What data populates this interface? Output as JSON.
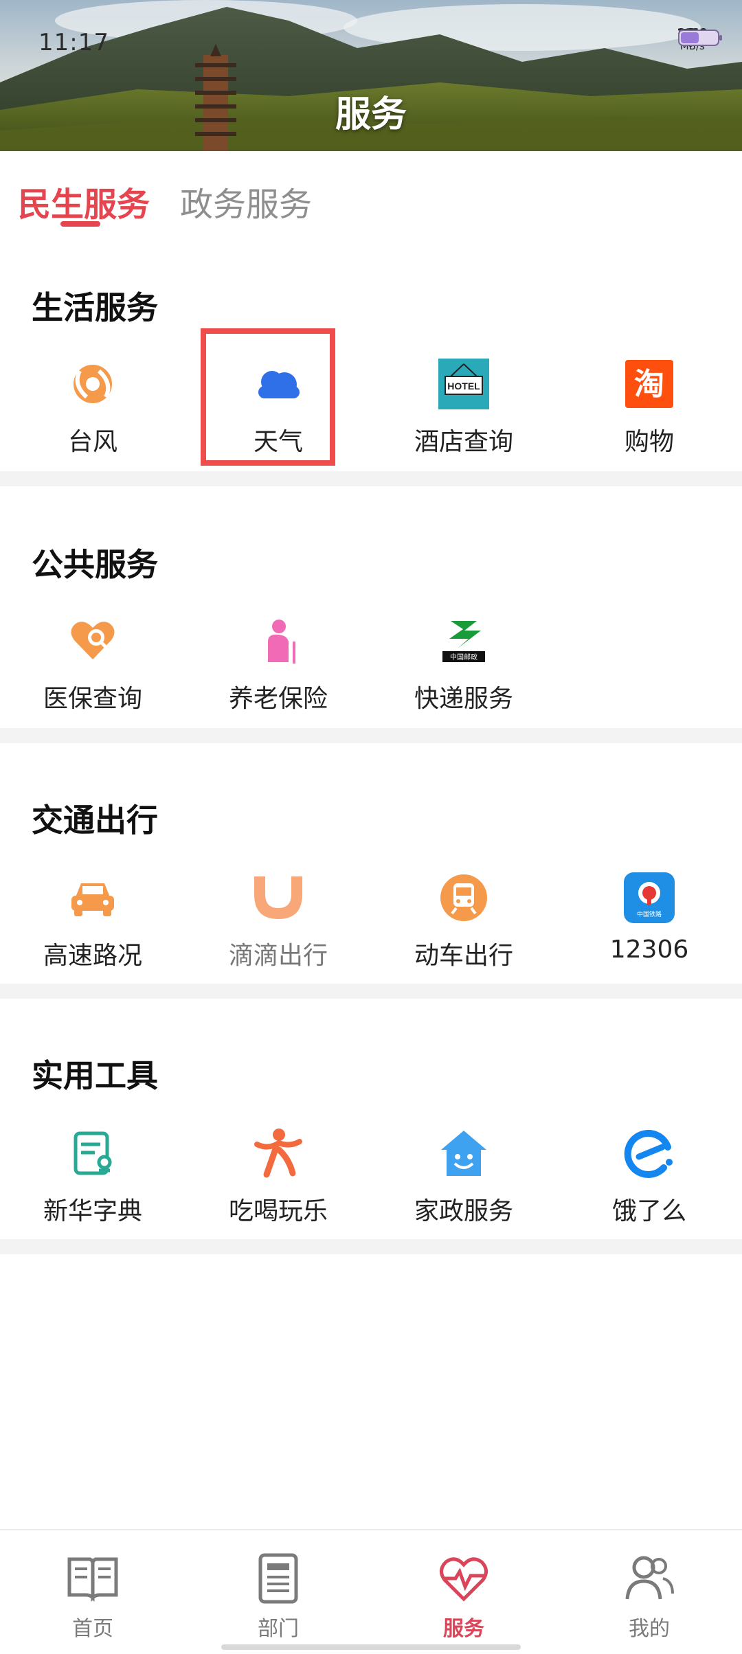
{
  "status_bar": {
    "time": "11:17",
    "net_speed": "2.60",
    "net_unit": "MB/s"
  },
  "header": {
    "title": "服务"
  },
  "tabs": [
    {
      "label": "民生服务",
      "active": true
    },
    {
      "label": "政务服务",
      "active": false
    }
  ],
  "sections": {
    "life": {
      "title": "生活服务",
      "items": [
        {
          "label": "台风",
          "icon": "typhoon-icon"
        },
        {
          "label": "天气",
          "icon": "cloud-icon"
        },
        {
          "label": "酒店查询",
          "icon": "hotel-icon",
          "icon_text": "HOTEL"
        },
        {
          "label": "购物",
          "icon": "taobao-icon",
          "icon_text": "淘"
        }
      ]
    },
    "public": {
      "title": "公共服务",
      "items": [
        {
          "label": "医保查询",
          "icon": "heart-search-icon"
        },
        {
          "label": "养老保险",
          "icon": "elderly-icon"
        },
        {
          "label": "快递服务",
          "icon": "china-post-icon",
          "icon_text": "中国邮政"
        }
      ]
    },
    "traffic": {
      "title": "交通出行",
      "items": [
        {
          "label": "高速路况",
          "icon": "car-icon"
        },
        {
          "label": "滴滴出行",
          "icon": "didi-icon"
        },
        {
          "label": "动车出行",
          "icon": "train-icon"
        },
        {
          "label": "12306",
          "icon": "china-railway-icon",
          "icon_text": "中国铁路"
        }
      ]
    },
    "tools": {
      "title": "实用工具",
      "items": [
        {
          "label": "新华字典",
          "icon": "dictionary-icon"
        },
        {
          "label": "吃喝玩乐",
          "icon": "person-fun-icon"
        },
        {
          "label": "家政服务",
          "icon": "house-smile-icon"
        },
        {
          "label": "饿了么",
          "icon": "eleme-icon"
        }
      ]
    }
  },
  "bottom_nav": [
    {
      "label": "首页",
      "icon": "book-icon",
      "active": false
    },
    {
      "label": "部门",
      "icon": "document-icon",
      "active": false
    },
    {
      "label": "服务",
      "icon": "heart-pulse-icon",
      "active": true
    },
    {
      "label": "我的",
      "icon": "user-icon",
      "active": false
    }
  ],
  "colors": {
    "accent": "#e5454f",
    "highlight": "#ef4c4c",
    "inactive": "#8e8e8e"
  }
}
